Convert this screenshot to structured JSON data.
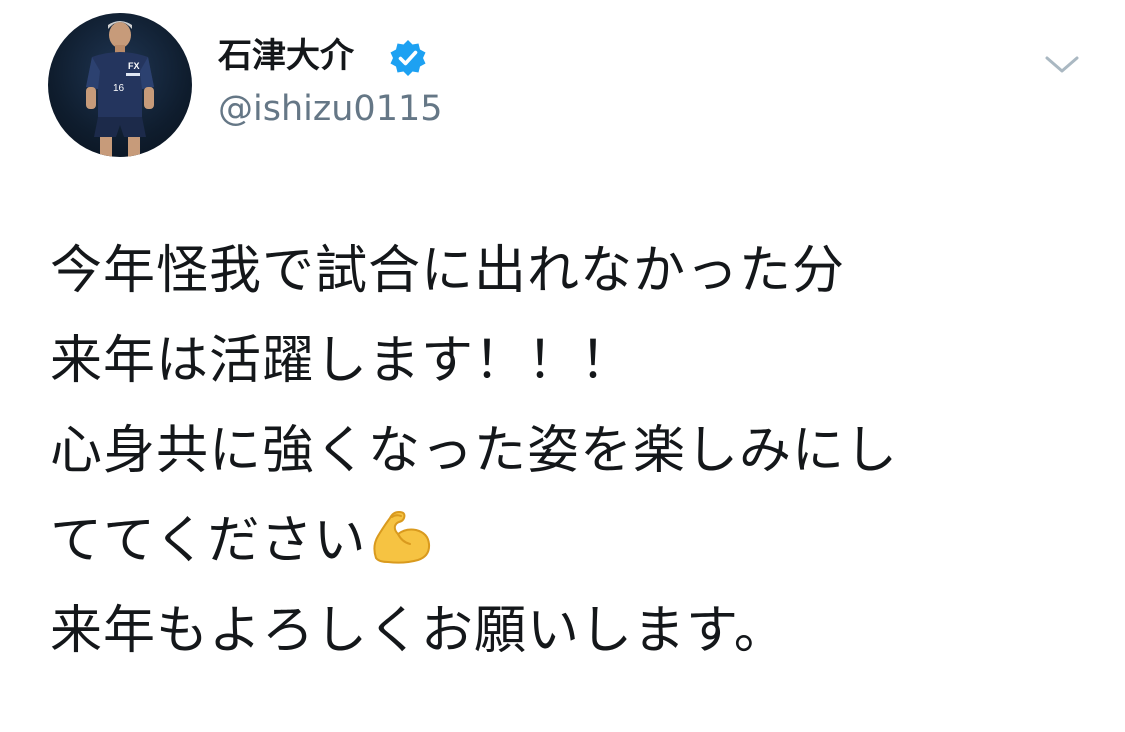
{
  "author": {
    "display_name": "石津大介",
    "handle": "@ishizu0115",
    "verified": true,
    "avatar_icon": "player-avatar",
    "jersey_number": "16"
  },
  "menu": {
    "icon": "chevron-down-icon"
  },
  "tweet": {
    "lines": [
      "今年怪我で試合に出れなかった分",
      "来年は活躍します！！！",
      "心身共に強くなった姿を楽しみにし",
      "ててください",
      "来年もよろしくお願いします。"
    ],
    "emoji": "flexed-biceps-icon"
  },
  "colors": {
    "text": "#14171a",
    "secondary": "#657786",
    "verified_blue": "#1da1f2",
    "caret": "#aab8c2"
  }
}
